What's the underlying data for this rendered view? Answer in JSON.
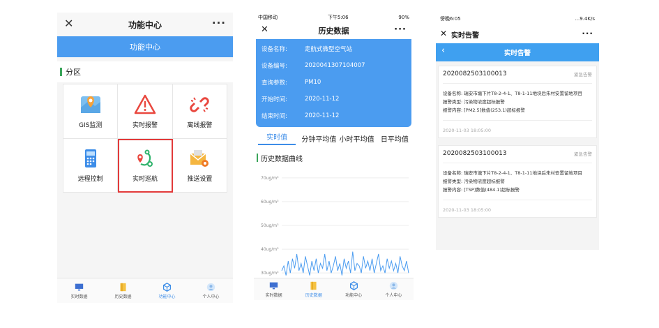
{
  "screen1": {
    "title": "功能中心",
    "banner": "功能中心",
    "section": "分区",
    "grid": [
      {
        "label": "GIS监测",
        "icon": "map-icon"
      },
      {
        "label": "实时报警",
        "icon": "warning-icon"
      },
      {
        "label": "离线报警",
        "icon": "broken-link-icon"
      },
      {
        "label": "远程控制",
        "icon": "remote-control-icon"
      },
      {
        "label": "实时巡航",
        "icon": "route-icon"
      },
      {
        "label": "推送设置",
        "icon": "mail-gear-icon"
      }
    ],
    "tabs": [
      "实时数据",
      "历史数据",
      "功能中心",
      "个人中心"
    ],
    "active_tab": 2
  },
  "screen2": {
    "status_left": "中国移动",
    "status_time": "下午5:06",
    "status_right": "90%",
    "title": "历史数据",
    "info": [
      {
        "k": "设备名称:",
        "v": "走航式微型空气站"
      },
      {
        "k": "设备编号:",
        "v": "2020041307104007"
      },
      {
        "k": "查询参数:",
        "v": "PM10"
      },
      {
        "k": "开始时间:",
        "v": "2020-11-12"
      },
      {
        "k": "结束时间:",
        "v": "2020-11-12"
      }
    ],
    "tabs": [
      "实时值",
      "分钟平均值",
      "小时平均值",
      "日平均值"
    ],
    "active_tab": 0,
    "section": "历史数据曲线",
    "bottom_tabs": [
      "实时数据",
      "历史数据",
      "功能中心",
      "个人中心"
    ],
    "active_bottom_tab": 1
  },
  "chart_data": {
    "type": "line",
    "ytick_labels": [
      "70ug/m³",
      "60ug/m³",
      "50ug/m³",
      "40ug/m³",
      "30ug/m³"
    ],
    "yticks": [
      70,
      60,
      50,
      40,
      30
    ],
    "ylim": [
      28,
      72
    ],
    "values": [
      31,
      33,
      29,
      35,
      30,
      36,
      32,
      38,
      31,
      34,
      30,
      37,
      33,
      29,
      35,
      31,
      36,
      30,
      34,
      32,
      38,
      31,
      35,
      30,
      33,
      37,
      31,
      34,
      29,
      36,
      32,
      35,
      30,
      39,
      31,
      34,
      33,
      30,
      37,
      32,
      35,
      31,
      36,
      30,
      34,
      38,
      31,
      33,
      30,
      36,
      32,
      35,
      31,
      34,
      30,
      37,
      33,
      31,
      35,
      30
    ],
    "color": "#4b9cf0"
  },
  "screen3": {
    "status_left": "傍晚6:05",
    "status_right": "...9.4K/s",
    "title": "实时告警",
    "banner": "实时告警",
    "alarms": [
      {
        "id": "2020082503100013",
        "level": "紧急告警",
        "device": "设备名称: 瑞安市塘下片T8-2-4-1、T8-1-11地块后朱村安置留地项目",
        "type": "报警类型: 污染物浓度超标报警",
        "content": "报警内容: [PM2.5]数值(253.1)超标报警",
        "time": "2020-11-03 18:05:00"
      },
      {
        "id": "2020082503100013",
        "level": "紧急告警",
        "device": "设备名称: 瑞安市塘下片T8-2-4-1、T8-1-11地块后朱村安置留地项目",
        "type": "报警类型: 污染物浓度超标报警",
        "content": "报警内容: [TSP]数值(484.1)超标报警",
        "time": "2020-11-03 18:05:00"
      }
    ]
  }
}
